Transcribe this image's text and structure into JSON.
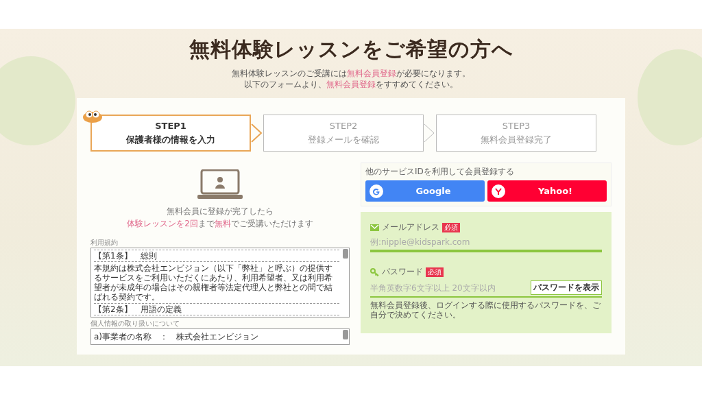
{
  "header": {
    "title": "無料体験レッスンをご希望の方へ",
    "lines": [
      [
        {
          "text": "無料体験レッスンのご受講には",
          "highlight": false
        },
        {
          "text": "無料会員登録",
          "highlight": true
        },
        {
          "text": "が必要になります。",
          "highlight": false
        }
      ],
      [
        {
          "text": "以下のフォームより、",
          "highlight": false
        },
        {
          "text": "無料会員登録",
          "highlight": true
        },
        {
          "text": "をすすめてください。",
          "highlight": false
        }
      ]
    ]
  },
  "steps": [
    {
      "label": "STEP1",
      "caption": "保護者様の情報を入力",
      "selected": true
    },
    {
      "label": "STEP2",
      "caption": "登録メールを確認",
      "selected": false
    },
    {
      "label": "STEP3",
      "caption": "無料会員登録完了",
      "selected": false
    }
  ],
  "benefit": {
    "line1": "無料会員に登録が完了したら",
    "line2": [
      {
        "text": "体験レッスンを2回",
        "highlight": true
      },
      {
        "text": "まで",
        "highlight": false
      },
      {
        "text": "無料",
        "highlight": true
      },
      {
        "text": "でご受講いただけます",
        "highlight": false
      }
    ]
  },
  "terms": {
    "label": "利用規約",
    "blocks": [
      {
        "kind": "heading",
        "text": "【第1条】　総則"
      },
      {
        "kind": "text",
        "text": "本規約は株式会社エンビジョン（以下「弊社」と呼ぶ）の提供するサービスをご利用いただくにあたり、利用希望者、又は利用希望者が未成年の場合はその親権者等法定代理人と弊社との間で結ばれる契約です。"
      },
      {
        "kind": "heading",
        "text": "【第2条】　用語の定義"
      }
    ]
  },
  "privacy": {
    "label": "個人情報の取り扱いについて",
    "blocks": [
      {
        "kind": "text",
        "text": "a)事業者の名称　：　株式会社エンビジョン"
      }
    ]
  },
  "social": {
    "title": "他のサービスIDを利用して会員登録する",
    "buttons": [
      {
        "kind": "google",
        "label": "Google"
      },
      {
        "kind": "yahoo",
        "label": "Yahoo!"
      }
    ]
  },
  "form": {
    "fields": [
      {
        "kind": "email",
        "label": "メールアドレス",
        "badge": "必須",
        "placeholder": "例:nipple@kidspark.com"
      },
      {
        "kind": "password",
        "label": "パスワード",
        "badge": "必須",
        "placeholder": "半角英数字6文字以上 20文字以内",
        "toggle": "パスワードを表示",
        "note": "無料会員登録後、ログインする際に使用するパスワードを、ご自分で決めてください。"
      }
    ]
  }
}
